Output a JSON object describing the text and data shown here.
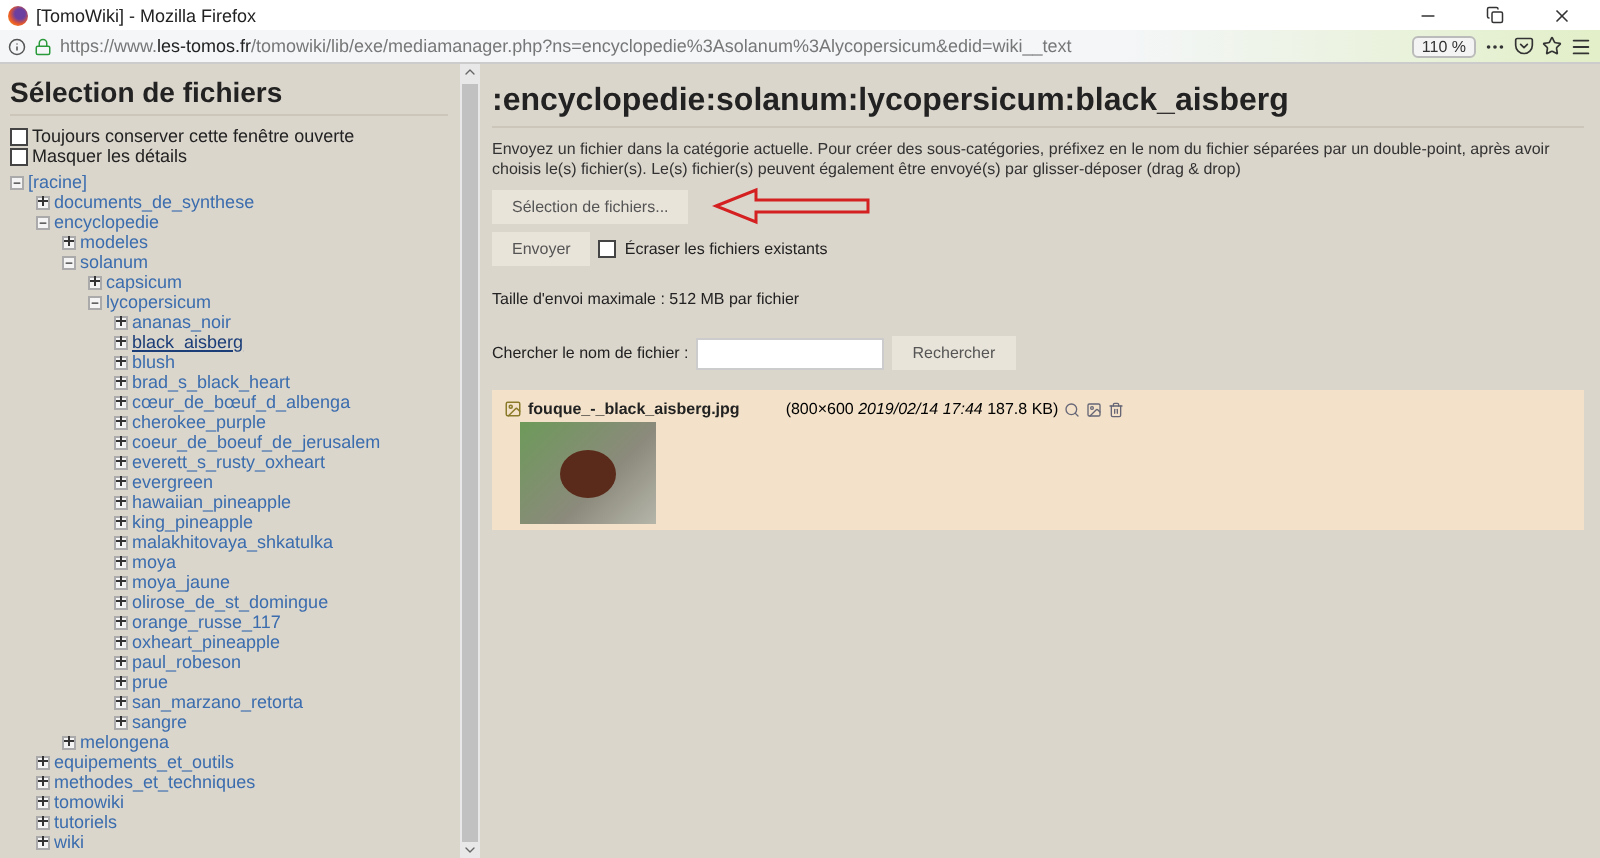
{
  "window": {
    "title": "[TomoWiki] - Mozilla Firefox"
  },
  "address_bar": {
    "url_prefix": "https://www.",
    "url_domain": "les-tomos.fr",
    "url_path": "/tomowiki/lib/exe/mediamanager.php?ns=encyclopedie%3Asolanum%3Alycopersicum&edid=wiki__text",
    "zoom": "110 %"
  },
  "sidebar": {
    "title": "Sélection de fichiers",
    "options": [
      {
        "label": "Toujours conserver cette fenêtre ouverte",
        "checked": false
      },
      {
        "label": "Masquer les détails",
        "checked": false
      }
    ],
    "tree": [
      {
        "label": "[racine]",
        "expanded": true,
        "selected": false,
        "children": [
          {
            "label": "documents_de_synthese",
            "expanded": false,
            "selected": false
          },
          {
            "label": "encyclopedie",
            "expanded": true,
            "selected": false,
            "children": [
              {
                "label": "modeles",
                "expanded": false,
                "selected": false
              },
              {
                "label": "solanum",
                "expanded": true,
                "selected": false,
                "children": [
                  {
                    "label": "capsicum",
                    "expanded": false,
                    "selected": false
                  },
                  {
                    "label": "lycopersicum",
                    "expanded": true,
                    "selected": false,
                    "children": [
                      {
                        "label": "ananas_noir",
                        "expanded": false,
                        "selected": false
                      },
                      {
                        "label": "black_aisberg",
                        "expanded": false,
                        "selected": true
                      },
                      {
                        "label": "blush",
                        "expanded": false,
                        "selected": false
                      },
                      {
                        "label": "brad_s_black_heart",
                        "expanded": false,
                        "selected": false
                      },
                      {
                        "label": "cœur_de_bœuf_d_albenga",
                        "expanded": false,
                        "selected": false
                      },
                      {
                        "label": "cherokee_purple",
                        "expanded": false,
                        "selected": false
                      },
                      {
                        "label": "coeur_de_boeuf_de_jerusalem",
                        "expanded": false,
                        "selected": false
                      },
                      {
                        "label": "everett_s_rusty_oxheart",
                        "expanded": false,
                        "selected": false
                      },
                      {
                        "label": "evergreen",
                        "expanded": false,
                        "selected": false
                      },
                      {
                        "label": "hawaiian_pineapple",
                        "expanded": false,
                        "selected": false
                      },
                      {
                        "label": "king_pineapple",
                        "expanded": false,
                        "selected": false
                      },
                      {
                        "label": "malakhitovaya_shkatulka",
                        "expanded": false,
                        "selected": false
                      },
                      {
                        "label": "moya",
                        "expanded": false,
                        "selected": false
                      },
                      {
                        "label": "moya_jaune",
                        "expanded": false,
                        "selected": false
                      },
                      {
                        "label": "olirose_de_st_domingue",
                        "expanded": false,
                        "selected": false
                      },
                      {
                        "label": "orange_russe_117",
                        "expanded": false,
                        "selected": false
                      },
                      {
                        "label": "oxheart_pineapple",
                        "expanded": false,
                        "selected": false
                      },
                      {
                        "label": "paul_robeson",
                        "expanded": false,
                        "selected": false
                      },
                      {
                        "label": "prue",
                        "expanded": false,
                        "selected": false
                      },
                      {
                        "label": "san_marzano_retorta",
                        "expanded": false,
                        "selected": false
                      },
                      {
                        "label": "sangre",
                        "expanded": false,
                        "selected": false
                      }
                    ]
                  }
                ]
              },
              {
                "label": "melongena",
                "expanded": false,
                "selected": false
              }
            ]
          },
          {
            "label": "equipements_et_outils",
            "expanded": false,
            "selected": false
          },
          {
            "label": "methodes_et_techniques",
            "expanded": false,
            "selected": false
          },
          {
            "label": "tomowiki",
            "expanded": false,
            "selected": false
          },
          {
            "label": "tutoriels",
            "expanded": false,
            "selected": false
          },
          {
            "label": "wiki",
            "expanded": false,
            "selected": false
          }
        ]
      }
    ]
  },
  "main": {
    "title": ":encyclopedie:solanum:lycopersicum:black_aisberg",
    "instructions": "Envoyez un fichier dans la catégorie actuelle. Pour créer des sous-catégories, préfixez en le nom du fichier séparées par un double-point, après avoir choisis le(s) fichier(s). Le(s) fichier(s) peuvent également être envoyé(s) par glisser-déposer (drag & drop)",
    "select_button": "Sélection de fichiers...",
    "upload_button": "Envoyer",
    "overwrite": {
      "label": "Écraser les fichiers existants",
      "checked": false
    },
    "max_size": "Taille d'envoi maximale : 512 MB par fichier",
    "search": {
      "label": "Chercher le nom de fichier :",
      "button": "Rechercher"
    },
    "files": [
      {
        "name": "fouque_-_black_aisberg.jpg",
        "details": "(800×600 *2019/02/14 17:44* 187.8 KB)"
      }
    ]
  }
}
